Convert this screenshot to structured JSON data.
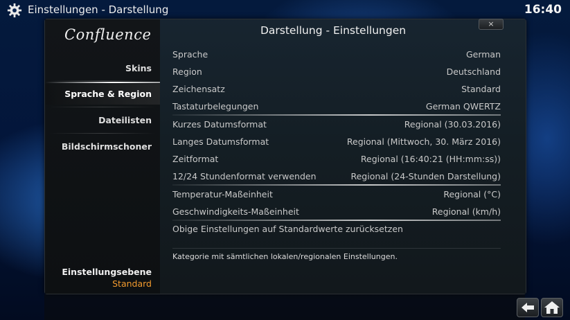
{
  "header": {
    "title": "Einstellungen  -  Darstellung",
    "clock": "16:40"
  },
  "sidebar": {
    "logo": "Confluence",
    "items": [
      {
        "label": "Skins"
      },
      {
        "label": "Sprache & Region"
      },
      {
        "label": "Dateilisten"
      },
      {
        "label": "Bildschirmschoner"
      }
    ],
    "selected_index": 1,
    "settings_level_label": "Einstellungsebene",
    "settings_level_value": "Standard"
  },
  "main": {
    "title": "Darstellung - Einstellungen",
    "close_label": "×",
    "settings": [
      {
        "label": "Sprache",
        "value": "German"
      },
      {
        "label": "Region",
        "value": "Deutschland"
      },
      {
        "label": "Zeichensatz",
        "value": "Standard"
      },
      {
        "label": "Tastaturbelegungen",
        "value": "German QWERTZ"
      },
      {
        "label": "Kurzes Datumsformat",
        "value": "Regional (30.03.2016)"
      },
      {
        "label": "Langes Datumsformat",
        "value": "Regional (Mittwoch, 30. März 2016)"
      },
      {
        "label": "Zeitformat",
        "value": "Regional (16:40:21 (HH:mm:ss))"
      },
      {
        "label": "12/24 Stundenformat verwenden",
        "value": "Regional (24-Stunden Darstellung)"
      },
      {
        "label": "Temperatur-Maßeinheit",
        "value": "Regional (°C)"
      },
      {
        "label": "Geschwindigkeits-Maßeinheit",
        "value": "Regional (km/h)"
      }
    ],
    "reset_label": "Obige Einstellungen auf Standardwerte zurücksetzen",
    "description": "Kategorie mit sämtlichen lokalen/regionalen Einstellungen."
  },
  "icons": {
    "header_icon": "gear-icon",
    "back_icon": "back-arrow-icon",
    "home_icon": "home-icon"
  },
  "colors": {
    "accent": "#f29a2e"
  }
}
